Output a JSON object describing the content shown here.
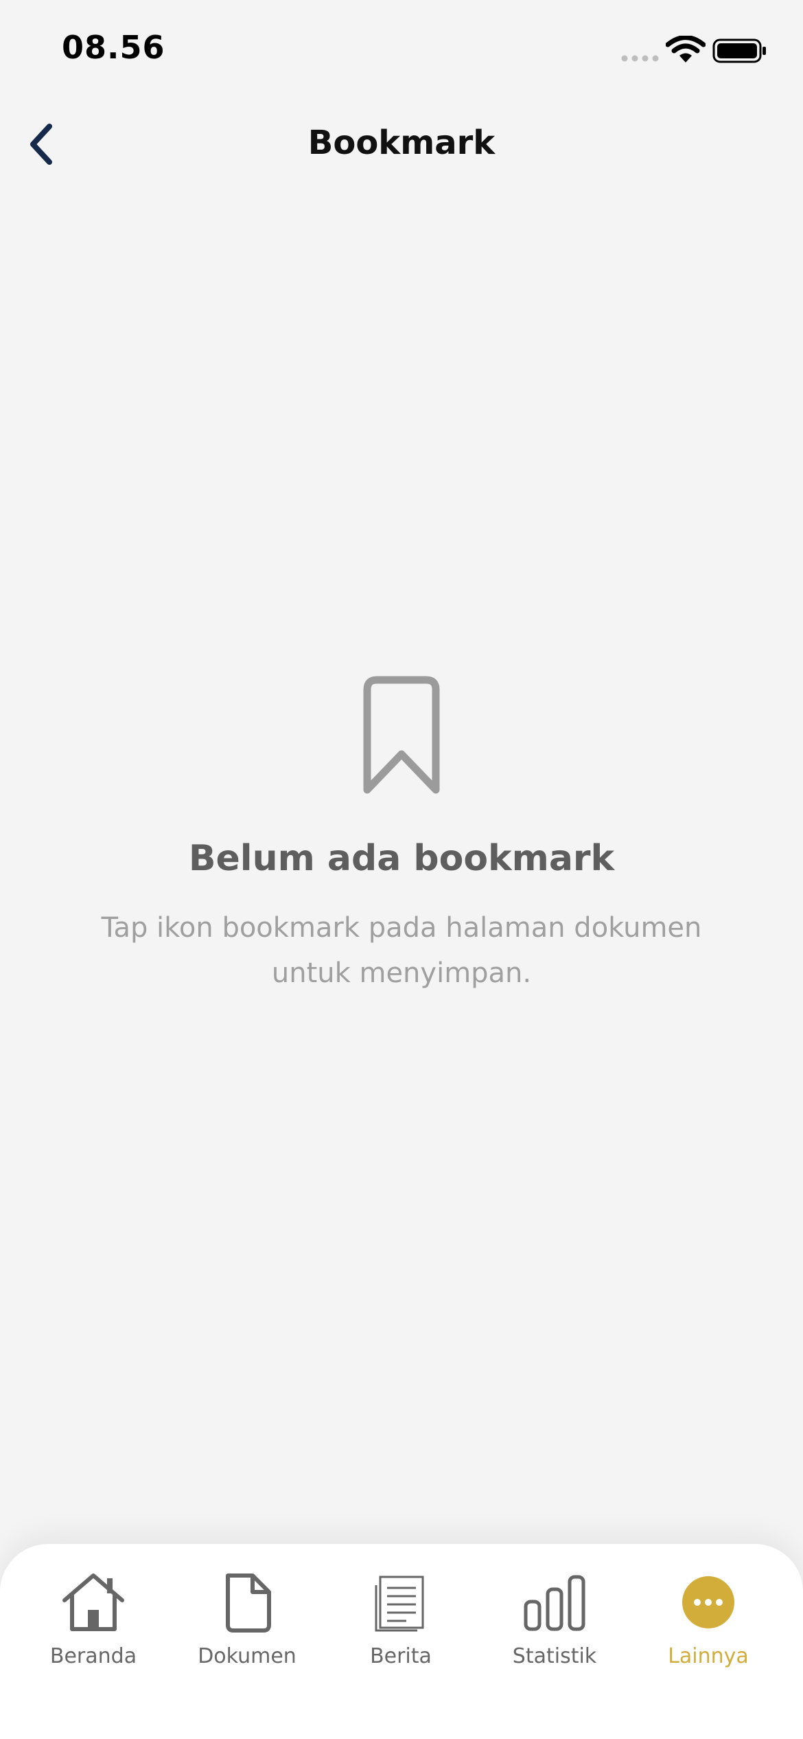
{
  "status_bar": {
    "time": "08.56"
  },
  "header": {
    "title": "Bookmark"
  },
  "empty_state": {
    "title": "Belum ada bookmark",
    "subtitle": "Tap ikon bookmark pada halaman dokumen untuk menyimpan.",
    "icon": "bookmark-icon"
  },
  "bottom_nav": {
    "items": [
      {
        "label": "Beranda",
        "icon": "home-icon",
        "active": false
      },
      {
        "label": "Dokumen",
        "icon": "document-icon",
        "active": false
      },
      {
        "label": "Berita",
        "icon": "news-icon",
        "active": false
      },
      {
        "label": "Statistik",
        "icon": "bar-chart-icon",
        "active": false
      },
      {
        "label": "Lainnya",
        "icon": "more-icon",
        "active": true
      }
    ]
  },
  "colors": {
    "background": "#f4f4f4",
    "accent": "#d3ad3a",
    "back_icon": "#15294a",
    "icon_gray": "#9b9b9b",
    "nav_gray": "#666666"
  }
}
